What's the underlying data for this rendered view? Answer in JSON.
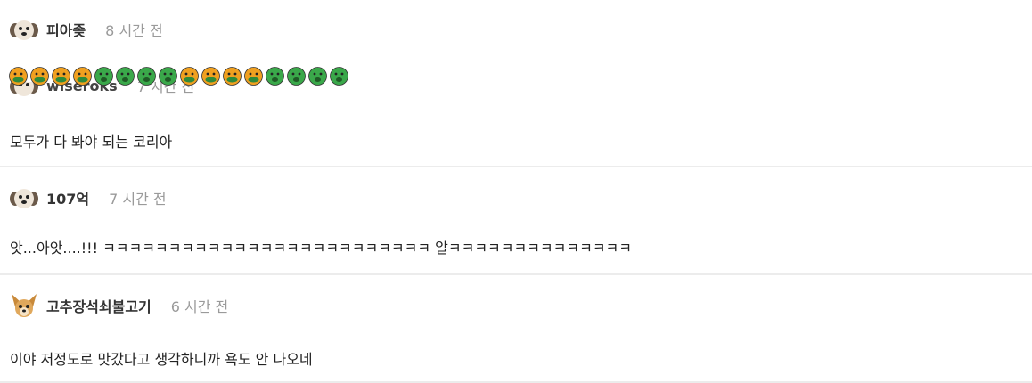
{
  "comments": [
    {
      "nickname": "피아좆",
      "time": "8 시간 전",
      "avatar_icon": "puppy-icon",
      "emojis": [
        "nauseated-face-icon",
        "nauseated-face-icon",
        "nauseated-face-icon",
        "nauseated-face-icon",
        "sick-face-icon",
        "sick-face-icon",
        "sick-face-icon",
        "sick-face-icon",
        "nauseated-face-icon",
        "nauseated-face-icon",
        "nauseated-face-icon",
        "nauseated-face-icon",
        "sick-face-icon",
        "sick-face-icon",
        "sick-face-icon",
        "sick-face-icon"
      ]
    },
    {
      "nickname": "wiseroks",
      "time": "7 시간 전",
      "avatar_icon": "puppy-icon",
      "text": "모두가 다 봐야 되는 코리아"
    },
    {
      "nickname": "107억",
      "time": "7 시간 전",
      "avatar_icon": "puppy-icon",
      "text": "앗...아앗....!!! ㅋㅋㅋㅋㅋㅋㅋㅋㅋㅋㅋㅋㅋㅋㅋㅋㅋㅋㅋㅋㅋㅋㅋㅋㅋ 알ㅋㅋㅋㅋㅋㅋㅋㅋㅋㅋㅋㅋㅋㅋ"
    },
    {
      "nickname": "고추장석쇠불고기",
      "time": "6 시간 전",
      "avatar_icon": "chihuahua-icon",
      "text": "이야 저정도로 맛갔다고 생각하니까 욕도 안 나오네"
    }
  ],
  "colors": {
    "nickname": "#333333",
    "time": "#9a9a9a",
    "separator": "#ececec",
    "nauseated": "#f0a020",
    "sick": "#3aa84a"
  }
}
